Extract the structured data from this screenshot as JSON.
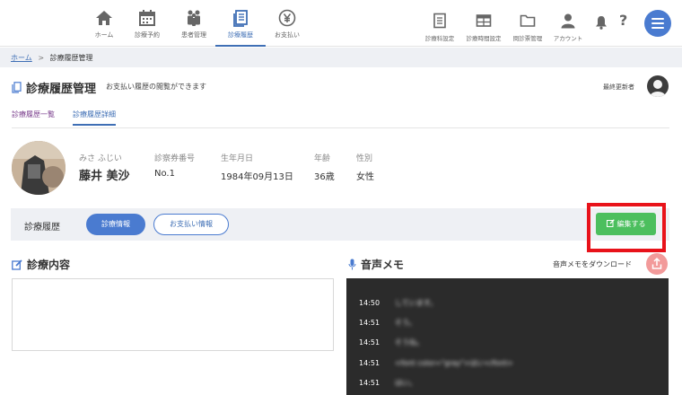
{
  "nav": {
    "items": [
      {
        "label": "ホーム",
        "icon": "home-icon"
      },
      {
        "label": "診療予約",
        "icon": "calendar-icon"
      },
      {
        "label": "患者管理",
        "icon": "patients-icon"
      },
      {
        "label": "診療履歴",
        "icon": "history-icon"
      },
      {
        "label": "お支払い",
        "icon": "yen-icon"
      }
    ],
    "active": "診療履歴",
    "right_items": [
      {
        "label": "診療科設定",
        "icon": "document-icon"
      },
      {
        "label": "診療時間設定",
        "icon": "schedule-icon"
      },
      {
        "label": "問診票管理",
        "icon": "folder-icon"
      },
      {
        "label": "アカウント",
        "icon": "user-icon"
      }
    ],
    "bell_icon": "bell-icon",
    "help_label": "?",
    "menu_icon": "hamburger-icon"
  },
  "breadcrumb": {
    "home": "ホーム",
    "separator": ">",
    "current": "診療履歴管理"
  },
  "header": {
    "title": "診療履歴管理",
    "subtitle": "お支払い履歴の閲覧ができます",
    "updater_label": "最終更新者"
  },
  "tabs": [
    "診療履歴一覧",
    "診療履歴詳細"
  ],
  "patient": {
    "fields": [
      "みさ ふじい",
      "診察券番号",
      "生年月日",
      "年齢",
      "性別"
    ],
    "name": "藤井 美沙",
    "card_number": "No.1",
    "birth_date": "1984年09月13日",
    "age": "36歳",
    "gender": "女性"
  },
  "record_bar": {
    "label": "診療履歴",
    "tab_info": "診療情報",
    "tab_payment": "お支払い情報",
    "edit_button": "編集する"
  },
  "content": {
    "title": "診療内容",
    "text": ""
  },
  "memo": {
    "title": "音声メモ",
    "download_label": "音声メモをダウンロード",
    "rows": [
      {
        "time": "14:50",
        "text": "しています。"
      },
      {
        "time": "14:51",
        "text": "そう。"
      },
      {
        "time": "14:51",
        "text": "そうね。"
      },
      {
        "time": "14:51",
        "text": "<font color=\"gray\">はい</font>"
      },
      {
        "time": "14:51",
        "text": "はい。"
      }
    ]
  },
  "colors": {
    "accent": "#4a7bd0",
    "edit_button": "#4cbf5e",
    "highlight": "#e8121a",
    "download_button": "#f29a9a",
    "memo_background": "#2b2b2b"
  }
}
